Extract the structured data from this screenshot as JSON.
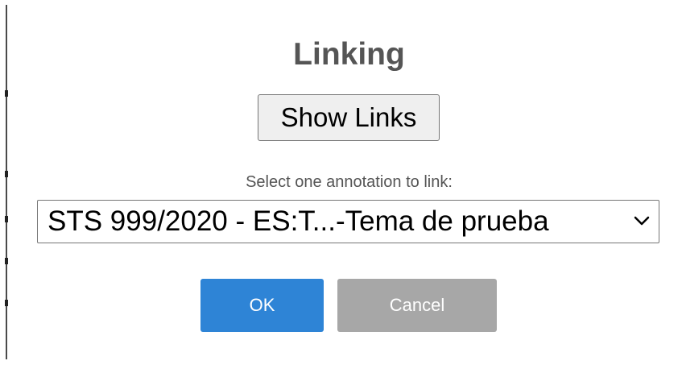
{
  "dialog": {
    "title": "Linking",
    "show_links_label": "Show Links",
    "select_label": "Select one annotation to link:",
    "select_value": "STS 999/2020 - ES:T...-Tema de prueba",
    "ok_label": "OK",
    "cancel_label": "Cancel"
  },
  "icons": {
    "dropdown": "chevron-down-icon"
  },
  "colors": {
    "title": "#555555",
    "ok_button": "#2e84d6",
    "cancel_button": "#a7a7a7"
  }
}
